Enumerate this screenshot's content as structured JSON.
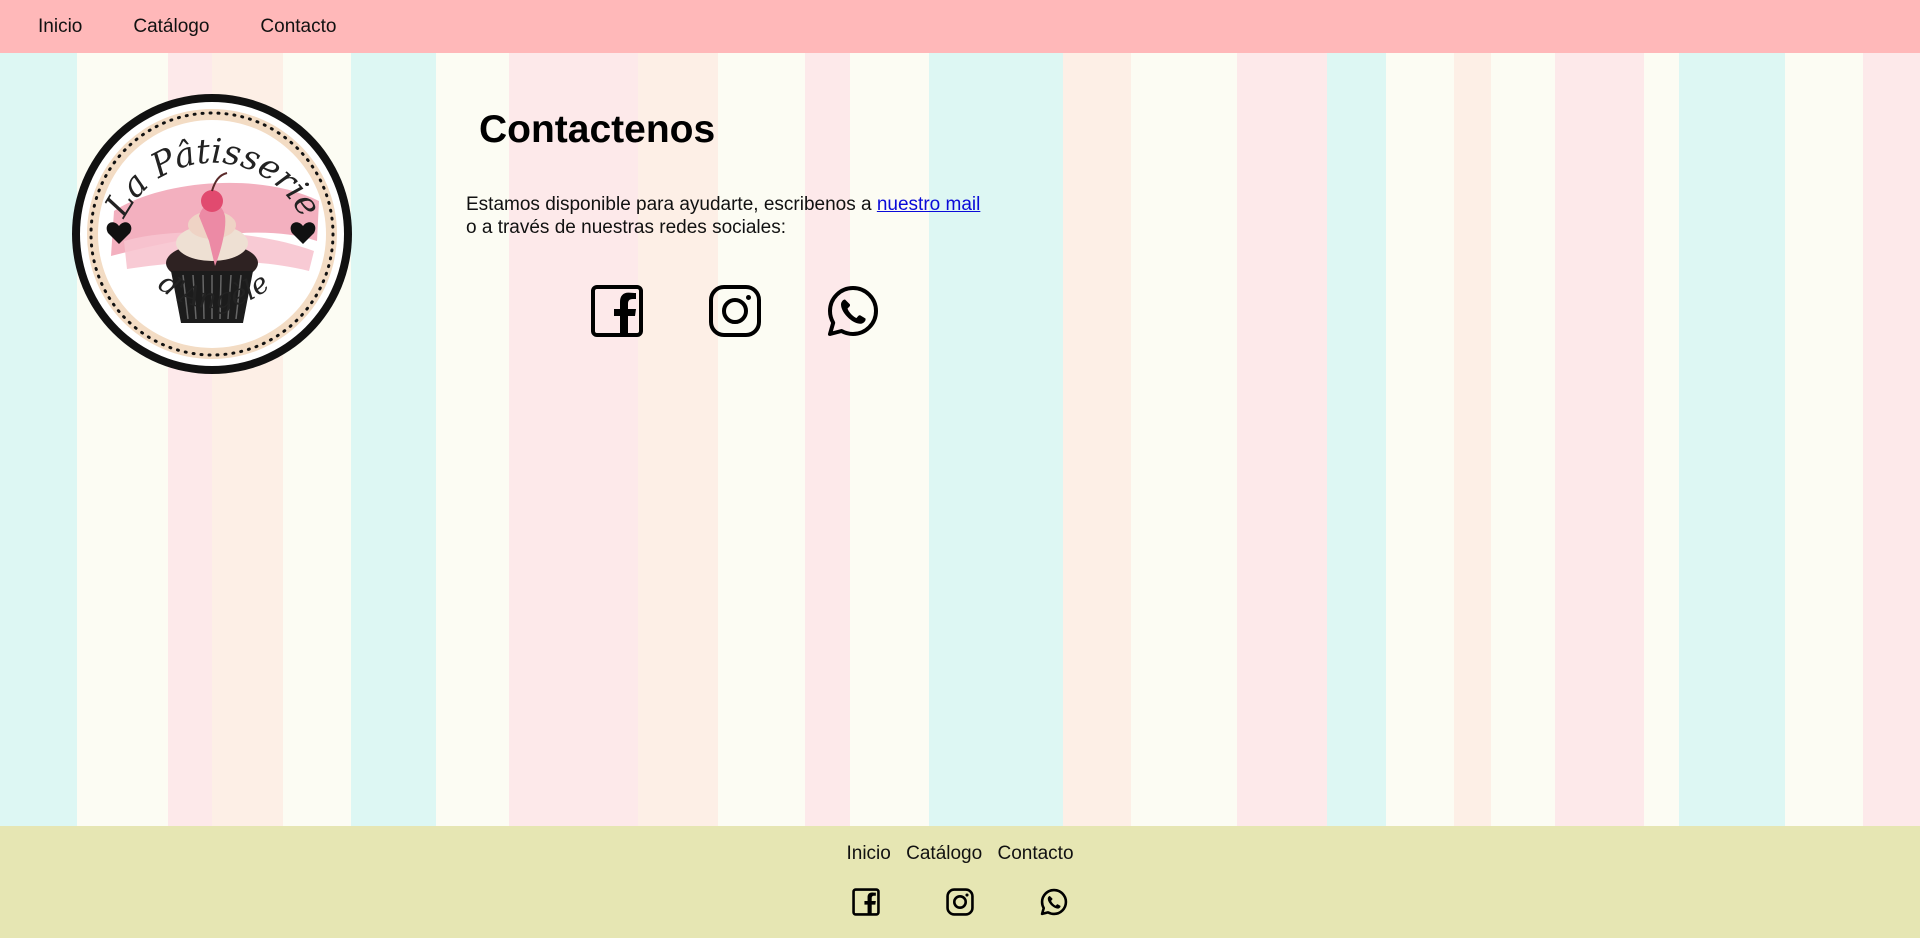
{
  "nav": {
    "items": [
      {
        "label": "Inicio"
      },
      {
        "label": "Catálogo"
      },
      {
        "label": "Contacto"
      }
    ]
  },
  "logo": {
    "brand_text": "La Pâtisserie d'Angèle",
    "colors": {
      "ring": "#111111",
      "accent": "#ef8fa6",
      "cream": "#f3dcc4"
    }
  },
  "contact": {
    "title": "Contactenos",
    "text_before_link": "Estamos disponible para ayudarte, escribenos a ",
    "link_text": "nuestro mail",
    "text_after_link": "o a través de nuestras redes sociales:"
  },
  "social": {
    "icons": [
      "facebook-icon",
      "instagram-icon",
      "whatsapp-icon"
    ]
  },
  "footer": {
    "nav": [
      {
        "label": "Inicio"
      },
      {
        "label": "Catálogo"
      },
      {
        "label": "Contacto"
      }
    ]
  },
  "colors": {
    "header_bg": "#ffb8b9",
    "footer_bg": "#e6e6b3",
    "link": "#0a0ad8"
  }
}
